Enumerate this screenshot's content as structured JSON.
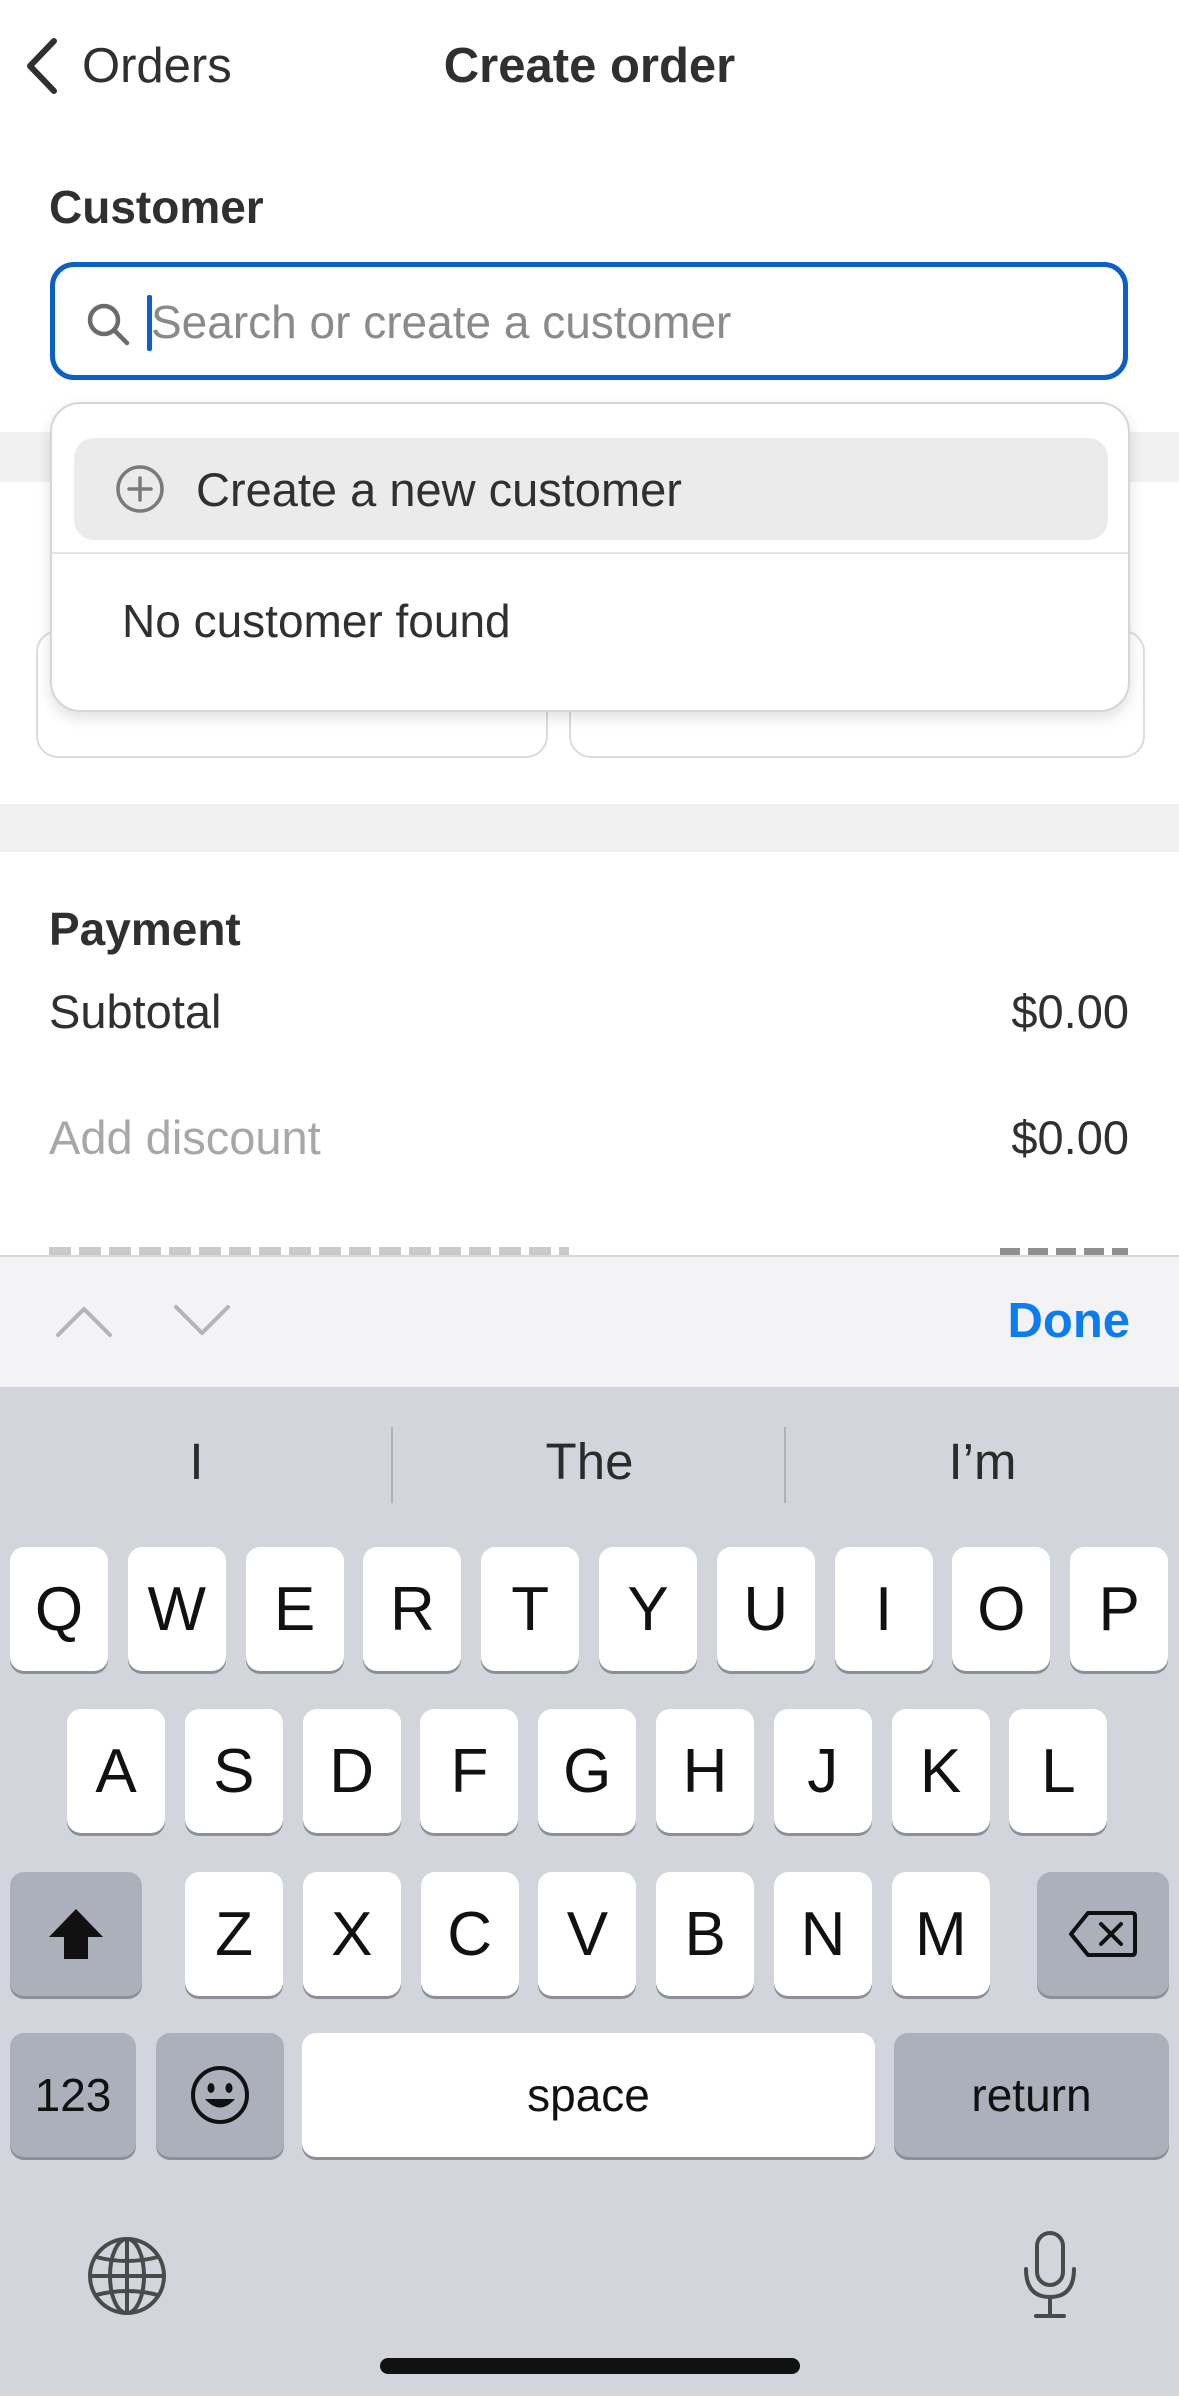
{
  "header": {
    "back_label": "Orders",
    "title": "Create order"
  },
  "customer": {
    "section_label": "Customer",
    "search_placeholder": "Search or create a customer"
  },
  "dropdown": {
    "create_label": "Create a new customer",
    "empty_label": "No customer found"
  },
  "payment": {
    "section_label": "Payment",
    "rows": [
      {
        "label": "Subtotal",
        "value": "$0.00"
      },
      {
        "label": "Add discount",
        "value": "$0.00"
      }
    ]
  },
  "accessory": {
    "done_label": "Done"
  },
  "keyboard": {
    "suggestions": [
      "I",
      "The",
      "I’m"
    ],
    "row1": [
      "Q",
      "W",
      "E",
      "R",
      "T",
      "Y",
      "U",
      "I",
      "O",
      "P"
    ],
    "row2": [
      "A",
      "S",
      "D",
      "F",
      "G",
      "H",
      "J",
      "K",
      "L"
    ],
    "row3": [
      "Z",
      "X",
      "C",
      "V",
      "B",
      "N",
      "M"
    ],
    "numbers_label": "123",
    "space_label": "space",
    "return_label": "return"
  },
  "colors": {
    "accent": "#0b5fc6",
    "done": "#0b7df0",
    "keyboard_bg": "#d3d5dc"
  }
}
